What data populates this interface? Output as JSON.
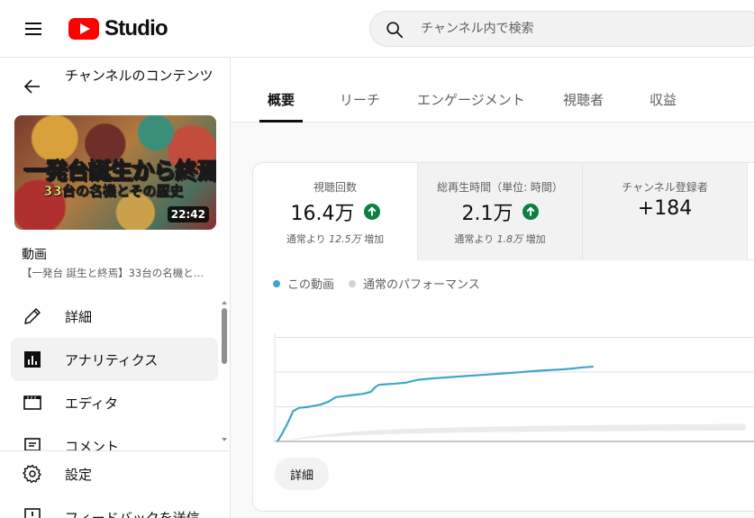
{
  "header": {
    "logo_text": "Studio",
    "search_placeholder": "チャンネル内で検索"
  },
  "sidebar": {
    "title": "チャンネルのコンテンツ",
    "thumbnail": {
      "line1": "一発台誕生から終焉",
      "line2": "33台の名機とその歴史",
      "duration": "22:42"
    },
    "video_label": "動画",
    "video_title": "【一発台 誕生と終焉】33台の名機と…",
    "items": [
      {
        "label": "詳細",
        "icon": "pencil-icon"
      },
      {
        "label": "アナリティクス",
        "icon": "analytics-icon",
        "active": true
      },
      {
        "label": "エディタ",
        "icon": "editor-icon"
      },
      {
        "label": "コメント",
        "icon": "comment-icon"
      }
    ],
    "bottom_items": [
      {
        "label": "設定",
        "icon": "gear-icon"
      },
      {
        "label": "フィードバックを送信",
        "icon": "feedback-icon"
      }
    ]
  },
  "tabs": [
    {
      "label": "概要",
      "active": true
    },
    {
      "label": "リーチ"
    },
    {
      "label": "エンゲージメント"
    },
    {
      "label": "視聴者"
    },
    {
      "label": "収益"
    }
  ],
  "metrics": [
    {
      "label": "視聴回数",
      "value": "16.4万",
      "sub_prefix": "通常より ",
      "sub_value": "12.5万",
      "sub_suffix": " 増加",
      "trend": "up"
    },
    {
      "label": "総再生時間（単位: 時間）",
      "value": "2.1万",
      "sub_prefix": "通常より ",
      "sub_value": "1.8万",
      "sub_suffix": " 増加",
      "trend": "up"
    },
    {
      "label": "チャンネル登録者",
      "value": "+184"
    }
  ],
  "colors": {
    "accent_line": "#3ea6cc",
    "typical_band": "#ebebeb",
    "up_badge": "#0b8043",
    "brand_red": "#ff0000"
  },
  "chart_data": {
    "type": "line",
    "x_ticks": [
      "0",
      "2",
      "4",
      "6",
      "8",
      "10",
      "12"
    ],
    "xlim": [
      0,
      12
    ],
    "series": [
      {
        "name": "この動画",
        "x": [
          0,
          0.1,
          0.25,
          0.4,
          0.55,
          0.8,
          1.1,
          1.3,
          1.5,
          1.9,
          2.2,
          2.4,
          2.5,
          2.6,
          3.0,
          3.3,
          3.6,
          4.0,
          4.4,
          4.8,
          5.2,
          5.6,
          6.0,
          6.4,
          6.8,
          7.2,
          7.5,
          7.8,
          8.1
        ],
        "y": [
          0,
          3,
          8,
          14,
          15.5,
          16,
          17,
          18.3,
          20.5,
          21.4,
          22,
          23,
          25,
          26.2,
          26.7,
          27.2,
          28.5,
          29.2,
          29.7,
          30.2,
          30.7,
          31.2,
          31.7,
          32.3,
          32.8,
          33.2,
          33.6,
          34.2,
          34.6
        ]
      },
      {
        "name": "通常のパフォーマンス",
        "x": [
          0,
          1,
          2,
          3,
          4,
          5,
          6,
          7,
          8,
          9,
          10,
          11,
          12
        ],
        "y_low": [
          0,
          1.8,
          2.8,
          3.4,
          3.9,
          4.2,
          4.4,
          4.6,
          4.7,
          4.8,
          4.9,
          5.0,
          5.0
        ],
        "y_high": [
          0,
          2.8,
          4.6,
          5.6,
          6.2,
          6.7,
          7.0,
          7.3,
          7.5,
          7.7,
          7.9,
          8.0,
          8.1
        ]
      }
    ],
    "grid": true
  },
  "details_button": "詳細"
}
